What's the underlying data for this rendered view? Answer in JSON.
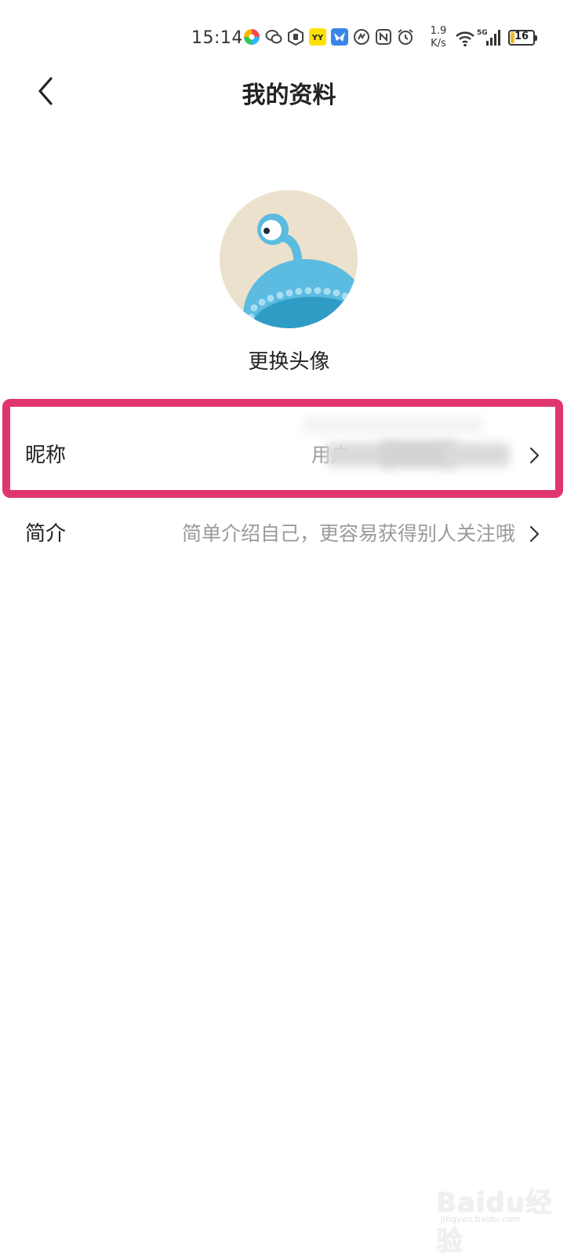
{
  "status_bar": {
    "time": "15:14",
    "net_speed_value": "1.9",
    "net_speed_unit": "K/s",
    "network_type": "5G",
    "battery_level": "16",
    "battery_fraction": 0.16,
    "battery_fill_color": "#f2b62b",
    "notification_icons": [
      "pinwheel-app-icon",
      "wechat-icon",
      "hexagon-app-icon",
      "yy-app-icon",
      "bird-app-icon",
      "speed-app-icon",
      "nfc-icon",
      "alarm-icon"
    ]
  },
  "header": {
    "title": "我的资料",
    "back_icon": "chevron-left-icon"
  },
  "avatar": {
    "change_label": "更换头像",
    "background_color": "#ebe1cc",
    "body_color": "#5bbbe0"
  },
  "profile_fields": [
    {
      "key": "nickname",
      "label": "昵称",
      "value": "用户",
      "value_obscured": true,
      "chevron_icon": "chevron-right-icon",
      "highlighted": true
    },
    {
      "key": "bio",
      "label": "简介",
      "value": "简单介绍自己，更容易获得别人关注哦",
      "chevron_icon": "chevron-right-icon"
    }
  ],
  "highlight": {
    "color": "#e0356e"
  },
  "watermark": {
    "logo": "Baidu经验",
    "url": "jingyan.baidu.com"
  }
}
